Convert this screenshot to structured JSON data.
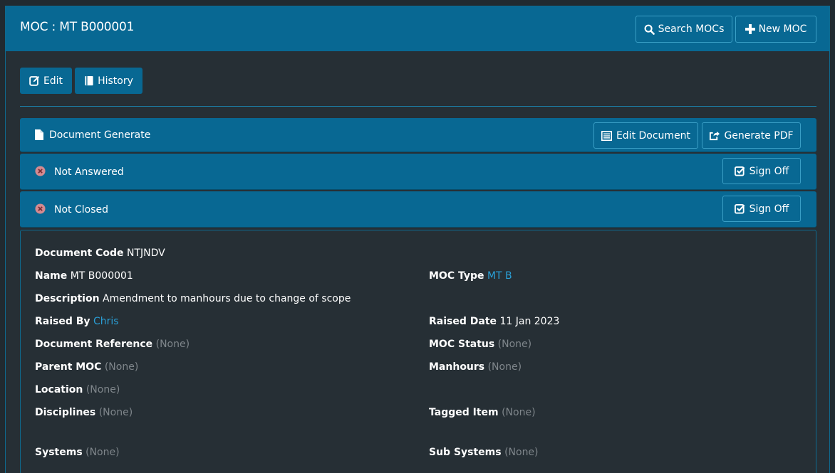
{
  "header": {
    "title": "MOC : MT B000001",
    "search_label": "Search MOCs",
    "new_label": "New MOC"
  },
  "toolbar": {
    "edit_label": "Edit",
    "history_label": "History"
  },
  "sections": {
    "document_generate": {
      "label": "Document Generate",
      "edit_document_label": "Edit Document",
      "generate_pdf_label": "Generate PDF"
    },
    "not_answered": {
      "label": "Not Answered",
      "sign_off_label": "Sign Off"
    },
    "not_closed": {
      "label": "Not Closed",
      "sign_off_label": "Sign Off"
    }
  },
  "details": {
    "document_code": {
      "label": "Document Code",
      "value": "NTJNDV"
    },
    "name": {
      "label": "Name",
      "value": "MT B000001"
    },
    "moc_type": {
      "label": "MOC Type",
      "value": "MT B"
    },
    "description": {
      "label": "Description",
      "value": "Amendment to manhours due to change of scope"
    },
    "raised_by": {
      "label": "Raised By",
      "value": "Chris"
    },
    "raised_date": {
      "label": "Raised Date",
      "value": "11 Jan 2023"
    },
    "document_reference": {
      "label": "Document Reference",
      "value": "(None)"
    },
    "moc_status": {
      "label": "MOC Status",
      "value": "(None)"
    },
    "parent_moc": {
      "label": "Parent MOC",
      "value": "(None)"
    },
    "manhours": {
      "label": "Manhours",
      "value": "(None)"
    },
    "location": {
      "label": "Location",
      "value": "(None)"
    },
    "disciplines": {
      "label": "Disciplines",
      "value": "(None)"
    },
    "tagged_item": {
      "label": "Tagged Item",
      "value": "(None)"
    },
    "systems": {
      "label": "Systems",
      "value": "(None)"
    },
    "sub_systems": {
      "label": "Sub Systems",
      "value": "(None)"
    }
  },
  "colors": {
    "page_background": "#212a30",
    "panel_background": "#262f35",
    "primary": "#086893",
    "link": "#2a9fd6",
    "muted": "#7f868b",
    "status_error": "#d9534f"
  }
}
